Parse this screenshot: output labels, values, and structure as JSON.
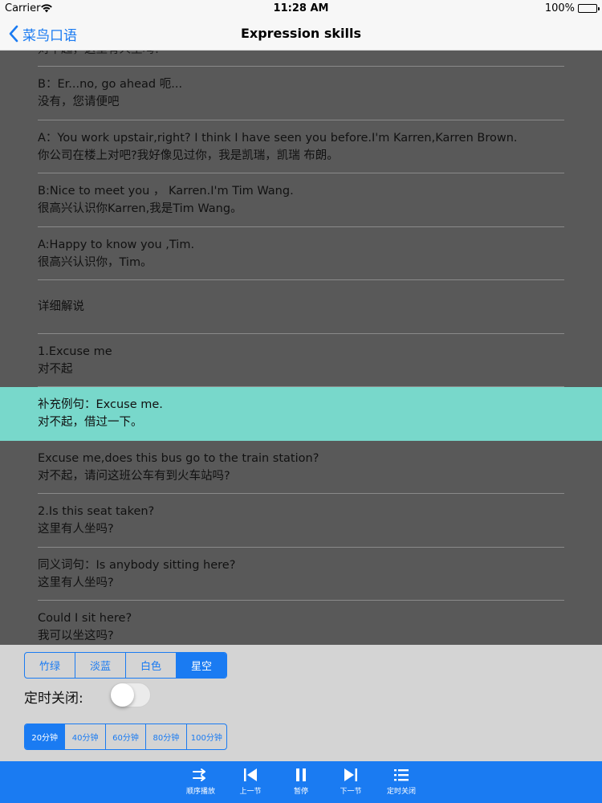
{
  "status_bar": {
    "carrier": "Carrier",
    "time": "11:28 AM",
    "battery": "100%"
  },
  "nav": {
    "back_label": "菜鸟口语",
    "title": "Expression skills"
  },
  "content": {
    "partial_top": "对不起，这里有人坐吗?",
    "rows": [
      {
        "en": "B：Er...no, go ahead 呃...",
        "zh": "没有，您请便吧"
      },
      {
        "en": "A：You work upstair,right? I think I have seen you before.I'm Karren,Karren Brown.",
        "zh": "你公司在楼上对吧?我好像见过你，我是凯瑞，凯瑞 布朗。"
      },
      {
        "en": "B:Nice to meet you ， Karren.I'm Tim Wang.",
        "zh": "很高兴认识你Karren,我是Tim Wang。"
      },
      {
        "en": "A:Happy to know you ,Tim.",
        "zh": "很高兴认识你，Tim。"
      },
      {
        "en": "详细解说",
        "zh": ""
      },
      {
        "en": "1.Excuse me",
        "zh": "对不起"
      },
      {
        "en": "补充例句：Excuse me.",
        "zh": "对不起，借过一下。"
      },
      {
        "en": "Excuse me,does this bus go to the train station?",
        "zh": "对不起，请问这班公车有到火车站吗?"
      },
      {
        "en": "2.Is this seat taken?",
        "zh": "这里有人坐吗?"
      },
      {
        "en": "同义词句：Is anybody sitting here?",
        "zh": "这里有人坐吗?"
      },
      {
        "en": "Could I sit here?",
        "zh": "我可以坐这吗?"
      }
    ],
    "highlight_index": 6
  },
  "theme_options": [
    "竹绿",
    "淡蓝",
    "白色",
    "星空"
  ],
  "theme_selected": 3,
  "timer": {
    "label": "定时关闭:",
    "enabled": false
  },
  "time_options": [
    "20分钟",
    "40分钟",
    "60分钟",
    "80分钟",
    "100分钟"
  ],
  "time_selected": 0,
  "toolbar": {
    "sequential": "顺序播放",
    "prev": "上一节",
    "pause": "暂停",
    "next": "下一节",
    "timer_off": "定时关闭"
  },
  "colors": {
    "accent": "#1a7bf2",
    "highlight": "#78d8cb",
    "background": "#595959",
    "panel": "#d4d4d4"
  }
}
